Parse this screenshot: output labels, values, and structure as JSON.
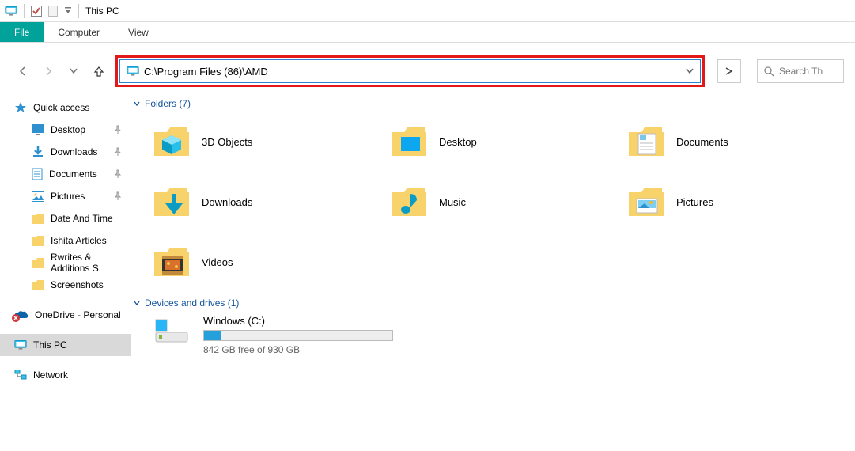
{
  "titlebar": {
    "title": "This PC"
  },
  "ribbon": {
    "file": "File",
    "computer": "Computer",
    "view": "View"
  },
  "address": {
    "value": "C:\\Program Files (86)\\AMD"
  },
  "search": {
    "placeholder": "Search Th"
  },
  "sidebar": {
    "quick": "Quick access",
    "items": [
      {
        "label": "Desktop",
        "pinned": true
      },
      {
        "label": "Downloads",
        "pinned": true
      },
      {
        "label": "Documents",
        "pinned": true
      },
      {
        "label": "Pictures",
        "pinned": true
      },
      {
        "label": "Date And Time"
      },
      {
        "label": "Ishita Articles"
      },
      {
        "label": "Rwrites & Additions S"
      },
      {
        "label": "Screenshots"
      }
    ],
    "onedrive": "OneDrive - Personal",
    "thispc": "This PC",
    "network": "Network"
  },
  "content": {
    "folders_hdr": "Folders (7)",
    "drives_hdr": "Devices and drives (1)",
    "folders": [
      {
        "label": "3D Objects"
      },
      {
        "label": "Desktop"
      },
      {
        "label": "Documents"
      },
      {
        "label": "Downloads"
      },
      {
        "label": "Music"
      },
      {
        "label": "Pictures"
      },
      {
        "label": "Videos"
      }
    ],
    "drive": {
      "name": "Windows (C:)",
      "free": "842 GB free of 930 GB"
    }
  }
}
